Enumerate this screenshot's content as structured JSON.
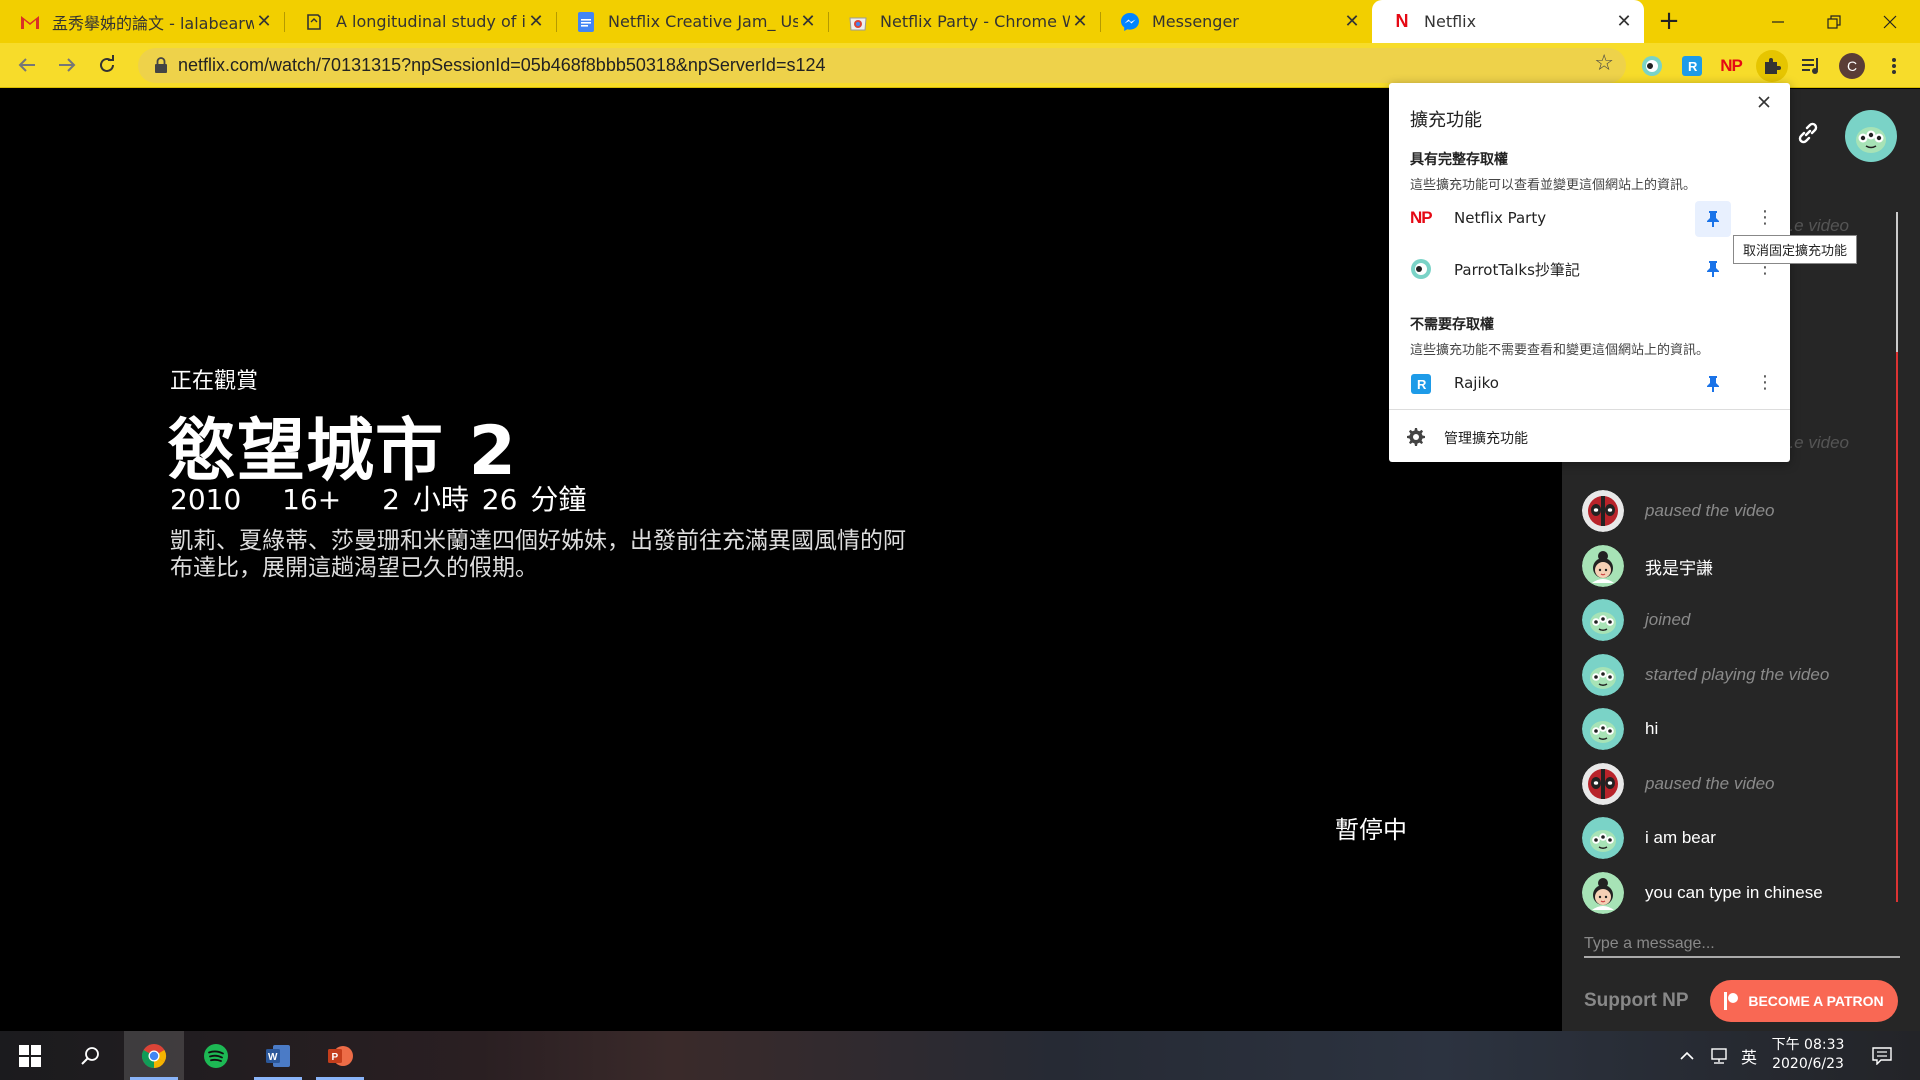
{
  "browser": {
    "tabs": [
      {
        "title": "孟秀擧姊的論文 - lalabearwang",
        "icon": "gmail-icon",
        "active": false
      },
      {
        "title": "A longitudinal study of intera",
        "icon": "document-chat-icon",
        "active": false
      },
      {
        "title": "Netflix Creative Jam_ User Inte",
        "icon": "google-docs-icon",
        "active": false
      },
      {
        "title": "Netflix Party - Chrome Web Sto",
        "icon": "chrome-web-store-icon",
        "active": false
      },
      {
        "title": "Messenger",
        "icon": "messenger-icon",
        "active": false
      },
      {
        "title": "Netflix",
        "icon": "netflix-icon",
        "active": true
      }
    ],
    "url": "netflix.com/watch/70131315?npSessionId=05b468f8bbb50318&npServerId=s124",
    "profile_initial": "C",
    "extension_labels": {
      "netflix_party": "NP"
    }
  },
  "video": {
    "now_watching": "正在觀賞",
    "title": "慾望城市 2",
    "year": "2010",
    "rating": "16+",
    "duration": "2 小時 26 分鐘",
    "description": "凱莉、夏綠蒂、莎曼珊和米蘭達四個好姊妹，出發前往充滿異國風情的阿布達比，展開這趟渴望已久的假期。",
    "status": "暫停中"
  },
  "chat": {
    "ghost_messages": [
      "...e video",
      "...e video"
    ],
    "messages": [
      {
        "avatar": "deadpool-avatar",
        "text": "paused the video",
        "system": true
      },
      {
        "avatar": "girl-avatar",
        "text": "我是宇謙",
        "system": false
      },
      {
        "avatar": "alien-avatar",
        "text": "joined",
        "system": true
      },
      {
        "avatar": "alien-avatar",
        "text": "started playing the video",
        "system": true
      },
      {
        "avatar": "alien-avatar",
        "text": "hi",
        "system": false
      },
      {
        "avatar": "deadpool-avatar",
        "text": "paused the video",
        "system": true
      },
      {
        "avatar": "alien-avatar",
        "text": "i am bear",
        "system": false
      },
      {
        "avatar": "girl-avatar",
        "text": "you can type in chinese",
        "system": false
      }
    ],
    "input_placeholder": "Type a message...",
    "support_label": "Support NP",
    "patron_label": "BECOME A PATRON"
  },
  "extensions_popup": {
    "title": "擴充功能",
    "full_access_heading": "具有完整存取權",
    "full_access_desc": "這些擴充功能可以查看並變更這個網站上的資訊。",
    "full_access_items": [
      {
        "name": "Netflix Party",
        "icon": "netflix-party-icon",
        "pinned": true
      },
      {
        "name": "ParrotTalks抄筆記",
        "icon": "parrottalks-icon",
        "pinned": true
      }
    ],
    "no_access_heading": "不需要存取權",
    "no_access_desc": "這些擴充功能不需要查看和變更這個網站上的資訊。",
    "no_access_items": [
      {
        "name": "Rajiko",
        "icon": "rajiko-icon",
        "pinned": true
      }
    ],
    "manage_label": "管理擴充功能",
    "tooltip": "取消固定擴充功能"
  },
  "taskbar": {
    "apps": [
      "start-icon",
      "search-icon",
      "chrome-icon",
      "spotify-icon",
      "word-icon",
      "powerpoint-icon"
    ],
    "ime": "英",
    "time": "下午 08:33",
    "date": "2020/6/23"
  },
  "colors": {
    "chrome_theme": "#f2cf00",
    "netflix_red": "#e50914",
    "patreon": "#f96854",
    "pin_blue": "#1a73e8",
    "sidebar_bg": "#262626"
  }
}
